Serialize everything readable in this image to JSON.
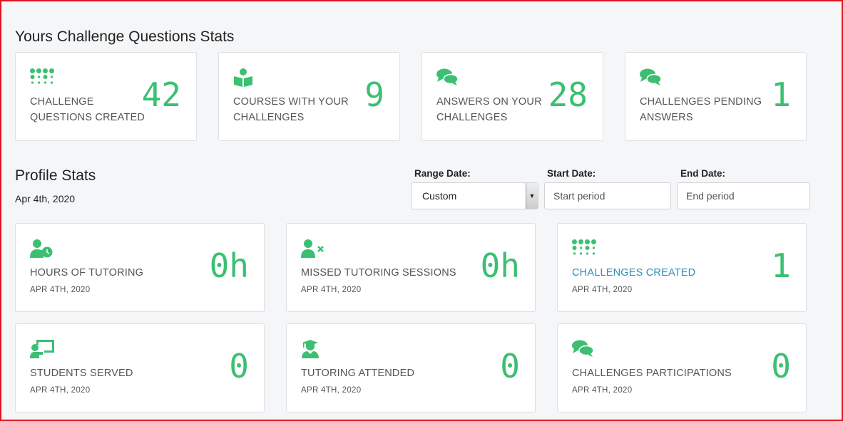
{
  "challenge_stats": {
    "title": "Yours Challenge Questions Stats",
    "cards": [
      {
        "icon": "braille-icon",
        "label_line1": "CHALLENGE",
        "label_line2": "QUESTIONS CREATED",
        "value": "42"
      },
      {
        "icon": "book-reader-icon",
        "label_line1": "COURSES WITH YOUR",
        "label_line2": "CHALLENGES",
        "value": "9"
      },
      {
        "icon": "comments-icon",
        "label_line1": "ANSWERS ON YOUR",
        "label_line2": "CHALLENGES",
        "value": "28"
      },
      {
        "icon": "comments-icon",
        "label_line1": "CHALLENGES PENDING",
        "label_line2": "ANSWERS",
        "value": "1"
      }
    ]
  },
  "profile_stats": {
    "title": "Profile Stats",
    "date": "Apr 4th, 2020",
    "range_date": {
      "label": "Range Date:",
      "value": "Custom"
    },
    "start_date": {
      "label": "Start Date:",
      "placeholder": "Start period"
    },
    "end_date": {
      "label": "End Date:",
      "placeholder": "End period"
    },
    "cards": [
      {
        "icon": "user-clock-icon",
        "label": "HOURS OF TUTORING",
        "sub": "APR 4TH, 2020",
        "value": "0h"
      },
      {
        "icon": "user-times-icon",
        "label": "MISSED TUTORING SESSIONS",
        "sub": "APR 4TH, 2020",
        "value": "0h"
      },
      {
        "icon": "braille-icon",
        "label": "CHALLENGES CREATED",
        "sub": "APR 4TH, 2020",
        "value": "1"
      },
      {
        "icon": "chalkboard-teacher-icon",
        "label": "STUDENTS SERVED",
        "sub": "APR 4TH, 2020",
        "value": "0"
      },
      {
        "icon": "user-graduate-icon",
        "label": "TUTORING ATTENDED",
        "sub": "APR 4TH, 2020",
        "value": "0"
      },
      {
        "icon": "comments-icon",
        "label": "CHALLENGES PARTICIPATIONS",
        "sub": "APR 4TH, 2020",
        "value": "0"
      }
    ]
  },
  "colors": {
    "accent": "#3cbf72",
    "link": "#2a8fb9",
    "frame": "#e0141c"
  }
}
